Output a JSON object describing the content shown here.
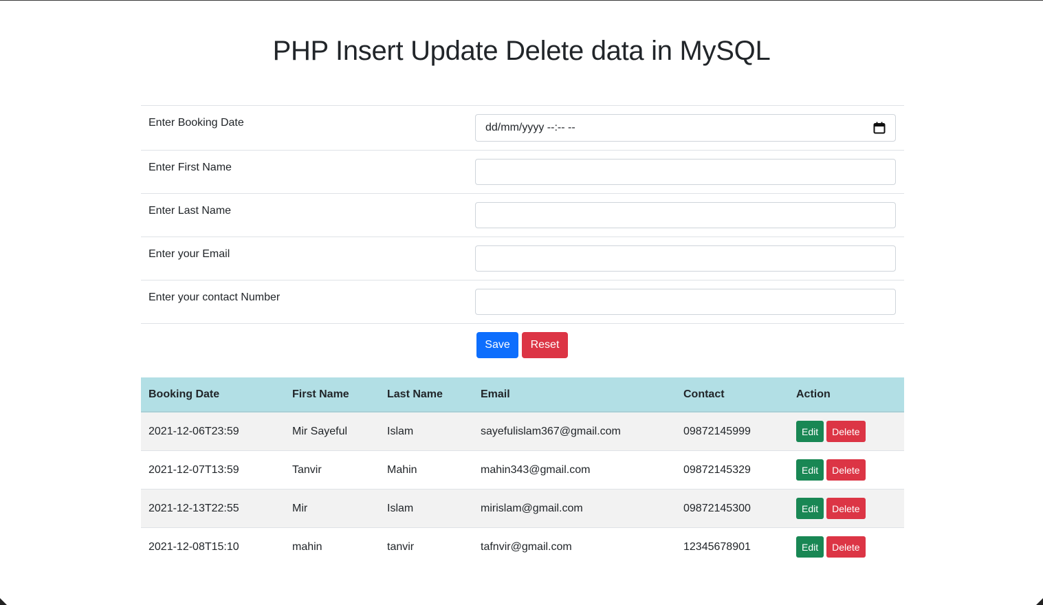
{
  "page": {
    "title": "PHP Insert Update Delete data in MySQL"
  },
  "form": {
    "booking_date": {
      "label": "Enter Booking Date",
      "placeholder": "dd/mm/yyyy --:-- --",
      "icon": "calendar-icon"
    },
    "first_name": {
      "label": "Enter First Name",
      "value": ""
    },
    "last_name": {
      "label": "Enter Last Name",
      "value": ""
    },
    "email": {
      "label": "Enter your Email",
      "value": ""
    },
    "contact": {
      "label": "Enter your contact Number",
      "value": ""
    },
    "save_label": "Save",
    "reset_label": "Reset"
  },
  "table": {
    "headers": [
      "Booking Date",
      "First Name",
      "Last Name",
      "Email",
      "Contact",
      "Action"
    ],
    "rows": [
      {
        "booking_date": "2021-12-06T23:59",
        "first_name": "Mir Sayeful",
        "last_name": "Islam",
        "email": "sayefulislam367@gmail.com",
        "contact": "09872145999"
      },
      {
        "booking_date": "2021-12-07T13:59",
        "first_name": "Tanvir",
        "last_name": "Mahin",
        "email": "mahin343@gmail.com",
        "contact": "09872145329"
      },
      {
        "booking_date": "2021-12-13T22:55",
        "first_name": "Mir",
        "last_name": "Islam",
        "email": "mirislam@gmail.com",
        "contact": "09872145300"
      },
      {
        "booking_date": "2021-12-08T15:10",
        "first_name": "mahin",
        "last_name": "tanvir",
        "email": "tafnvir@gmail.com",
        "contact": "12345678901"
      }
    ],
    "edit_label": "Edit",
    "delete_label": "Delete"
  },
  "colors": {
    "primary": "#0d6efd",
    "danger": "#dc3545",
    "success": "#198754",
    "header_bg": "#b2dfe5"
  }
}
